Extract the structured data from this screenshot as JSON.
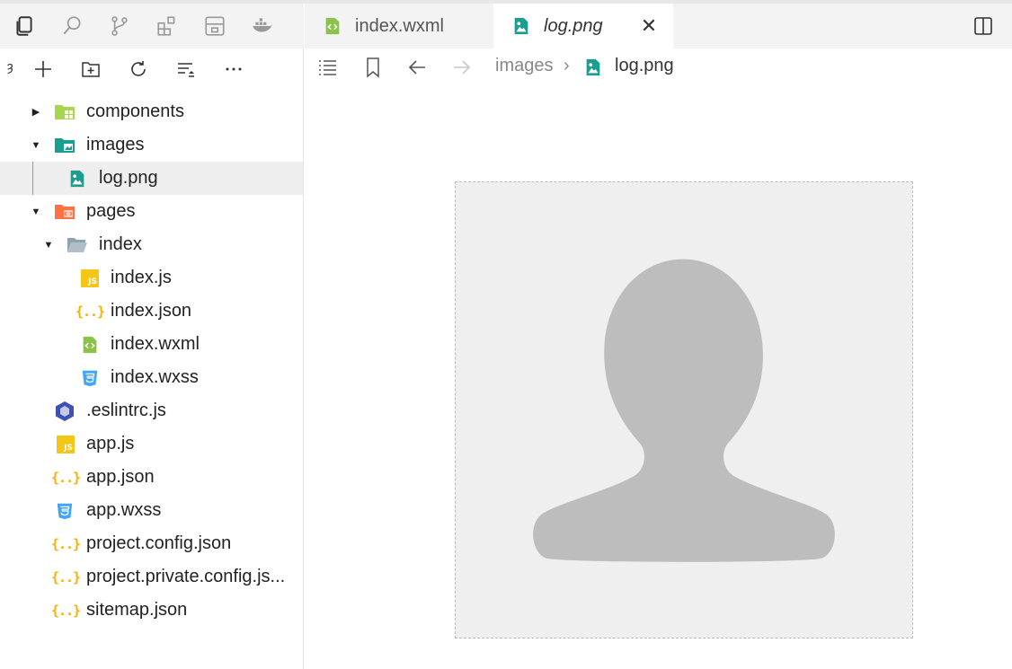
{
  "activity_bar": {
    "icons": [
      "explorer-icon",
      "search-icon",
      "source-control-icon",
      "extensions-icon",
      "layout-icon",
      "docker-icon"
    ]
  },
  "explorer_toolbar": {
    "first_glyph": "ȝ",
    "icons": [
      "new-file-icon",
      "new-folder-icon",
      "refresh-icon",
      "collapse-icon",
      "more-icon"
    ]
  },
  "tree": {
    "components": "components",
    "images": "images",
    "log_png": "log.png",
    "pages": "pages",
    "index_folder": "index",
    "index_js": "index.js",
    "index_json": "index.json",
    "index_wxml": "index.wxml",
    "index_wxss": "index.wxss",
    "eslintrc": ".eslintrc.js",
    "app_js": "app.js",
    "app_json": "app.json",
    "app_wxss": "app.wxss",
    "project_config": "project.config.json",
    "project_private_config": "project.private.config.js...",
    "sitemap": "sitemap.json"
  },
  "tabs": {
    "inactive_label": "index.wxml",
    "active_label": "log.png",
    "close_glyph": "✕"
  },
  "breadcrumb": {
    "folder": "images",
    "separator": "›",
    "file": "log.png"
  },
  "colors": {
    "accent_teal": "#1a9e8f",
    "wxml_green": "#8bc34a",
    "js_yellow": "#f5c518",
    "wxss_blue": "#42a5f5",
    "folder_orange": "#ff7043",
    "avatar_gray": "#bdbdbd"
  }
}
